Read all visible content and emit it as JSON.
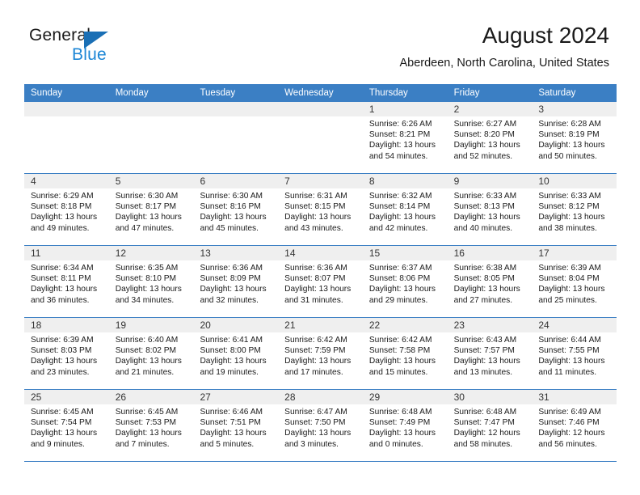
{
  "brand": {
    "name_top": "General",
    "name_bottom": "Blue",
    "accent_color": "#1c86d6",
    "triangle_color": "#1a6fb5"
  },
  "header": {
    "title": "August 2024",
    "subtitle": "Aberdeen, North Carolina, United States"
  },
  "theme": {
    "header_row_bg": "#3b7fc4",
    "day_band_bg": "#efefef",
    "grid_line": "#3b7fc4",
    "text": "#1a1a1a"
  },
  "weekdays": [
    "Sunday",
    "Monday",
    "Tuesday",
    "Wednesday",
    "Thursday",
    "Friday",
    "Saturday"
  ],
  "weeks": [
    [
      {
        "day": "",
        "empty": true
      },
      {
        "day": "",
        "empty": true
      },
      {
        "day": "",
        "empty": true
      },
      {
        "day": "",
        "empty": true
      },
      {
        "day": "1",
        "sunrise": "Sunrise: 6:26 AM",
        "sunset": "Sunset: 8:21 PM",
        "daylight1": "Daylight: 13 hours",
        "daylight2": "and 54 minutes."
      },
      {
        "day": "2",
        "sunrise": "Sunrise: 6:27 AM",
        "sunset": "Sunset: 8:20 PM",
        "daylight1": "Daylight: 13 hours",
        "daylight2": "and 52 minutes."
      },
      {
        "day": "3",
        "sunrise": "Sunrise: 6:28 AM",
        "sunset": "Sunset: 8:19 PM",
        "daylight1": "Daylight: 13 hours",
        "daylight2": "and 50 minutes."
      }
    ],
    [
      {
        "day": "4",
        "sunrise": "Sunrise: 6:29 AM",
        "sunset": "Sunset: 8:18 PM",
        "daylight1": "Daylight: 13 hours",
        "daylight2": "and 49 minutes."
      },
      {
        "day": "5",
        "sunrise": "Sunrise: 6:30 AM",
        "sunset": "Sunset: 8:17 PM",
        "daylight1": "Daylight: 13 hours",
        "daylight2": "and 47 minutes."
      },
      {
        "day": "6",
        "sunrise": "Sunrise: 6:30 AM",
        "sunset": "Sunset: 8:16 PM",
        "daylight1": "Daylight: 13 hours",
        "daylight2": "and 45 minutes."
      },
      {
        "day": "7",
        "sunrise": "Sunrise: 6:31 AM",
        "sunset": "Sunset: 8:15 PM",
        "daylight1": "Daylight: 13 hours",
        "daylight2": "and 43 minutes."
      },
      {
        "day": "8",
        "sunrise": "Sunrise: 6:32 AM",
        "sunset": "Sunset: 8:14 PM",
        "daylight1": "Daylight: 13 hours",
        "daylight2": "and 42 minutes."
      },
      {
        "day": "9",
        "sunrise": "Sunrise: 6:33 AM",
        "sunset": "Sunset: 8:13 PM",
        "daylight1": "Daylight: 13 hours",
        "daylight2": "and 40 minutes."
      },
      {
        "day": "10",
        "sunrise": "Sunrise: 6:33 AM",
        "sunset": "Sunset: 8:12 PM",
        "daylight1": "Daylight: 13 hours",
        "daylight2": "and 38 minutes."
      }
    ],
    [
      {
        "day": "11",
        "sunrise": "Sunrise: 6:34 AM",
        "sunset": "Sunset: 8:11 PM",
        "daylight1": "Daylight: 13 hours",
        "daylight2": "and 36 minutes."
      },
      {
        "day": "12",
        "sunrise": "Sunrise: 6:35 AM",
        "sunset": "Sunset: 8:10 PM",
        "daylight1": "Daylight: 13 hours",
        "daylight2": "and 34 minutes."
      },
      {
        "day": "13",
        "sunrise": "Sunrise: 6:36 AM",
        "sunset": "Sunset: 8:09 PM",
        "daylight1": "Daylight: 13 hours",
        "daylight2": "and 32 minutes."
      },
      {
        "day": "14",
        "sunrise": "Sunrise: 6:36 AM",
        "sunset": "Sunset: 8:07 PM",
        "daylight1": "Daylight: 13 hours",
        "daylight2": "and 31 minutes."
      },
      {
        "day": "15",
        "sunrise": "Sunrise: 6:37 AM",
        "sunset": "Sunset: 8:06 PM",
        "daylight1": "Daylight: 13 hours",
        "daylight2": "and 29 minutes."
      },
      {
        "day": "16",
        "sunrise": "Sunrise: 6:38 AM",
        "sunset": "Sunset: 8:05 PM",
        "daylight1": "Daylight: 13 hours",
        "daylight2": "and 27 minutes."
      },
      {
        "day": "17",
        "sunrise": "Sunrise: 6:39 AM",
        "sunset": "Sunset: 8:04 PM",
        "daylight1": "Daylight: 13 hours",
        "daylight2": "and 25 minutes."
      }
    ],
    [
      {
        "day": "18",
        "sunrise": "Sunrise: 6:39 AM",
        "sunset": "Sunset: 8:03 PM",
        "daylight1": "Daylight: 13 hours",
        "daylight2": "and 23 minutes."
      },
      {
        "day": "19",
        "sunrise": "Sunrise: 6:40 AM",
        "sunset": "Sunset: 8:02 PM",
        "daylight1": "Daylight: 13 hours",
        "daylight2": "and 21 minutes."
      },
      {
        "day": "20",
        "sunrise": "Sunrise: 6:41 AM",
        "sunset": "Sunset: 8:00 PM",
        "daylight1": "Daylight: 13 hours",
        "daylight2": "and 19 minutes."
      },
      {
        "day": "21",
        "sunrise": "Sunrise: 6:42 AM",
        "sunset": "Sunset: 7:59 PM",
        "daylight1": "Daylight: 13 hours",
        "daylight2": "and 17 minutes."
      },
      {
        "day": "22",
        "sunrise": "Sunrise: 6:42 AM",
        "sunset": "Sunset: 7:58 PM",
        "daylight1": "Daylight: 13 hours",
        "daylight2": "and 15 minutes."
      },
      {
        "day": "23",
        "sunrise": "Sunrise: 6:43 AM",
        "sunset": "Sunset: 7:57 PM",
        "daylight1": "Daylight: 13 hours",
        "daylight2": "and 13 minutes."
      },
      {
        "day": "24",
        "sunrise": "Sunrise: 6:44 AM",
        "sunset": "Sunset: 7:55 PM",
        "daylight1": "Daylight: 13 hours",
        "daylight2": "and 11 minutes."
      }
    ],
    [
      {
        "day": "25",
        "sunrise": "Sunrise: 6:45 AM",
        "sunset": "Sunset: 7:54 PM",
        "daylight1": "Daylight: 13 hours",
        "daylight2": "and 9 minutes."
      },
      {
        "day": "26",
        "sunrise": "Sunrise: 6:45 AM",
        "sunset": "Sunset: 7:53 PM",
        "daylight1": "Daylight: 13 hours",
        "daylight2": "and 7 minutes."
      },
      {
        "day": "27",
        "sunrise": "Sunrise: 6:46 AM",
        "sunset": "Sunset: 7:51 PM",
        "daylight1": "Daylight: 13 hours",
        "daylight2": "and 5 minutes."
      },
      {
        "day": "28",
        "sunrise": "Sunrise: 6:47 AM",
        "sunset": "Sunset: 7:50 PM",
        "daylight1": "Daylight: 13 hours",
        "daylight2": "and 3 minutes."
      },
      {
        "day": "29",
        "sunrise": "Sunrise: 6:48 AM",
        "sunset": "Sunset: 7:49 PM",
        "daylight1": "Daylight: 13 hours",
        "daylight2": "and 0 minutes."
      },
      {
        "day": "30",
        "sunrise": "Sunrise: 6:48 AM",
        "sunset": "Sunset: 7:47 PM",
        "daylight1": "Daylight: 12 hours",
        "daylight2": "and 58 minutes."
      },
      {
        "day": "31",
        "sunrise": "Sunrise: 6:49 AM",
        "sunset": "Sunset: 7:46 PM",
        "daylight1": "Daylight: 12 hours",
        "daylight2": "and 56 minutes."
      }
    ]
  ]
}
